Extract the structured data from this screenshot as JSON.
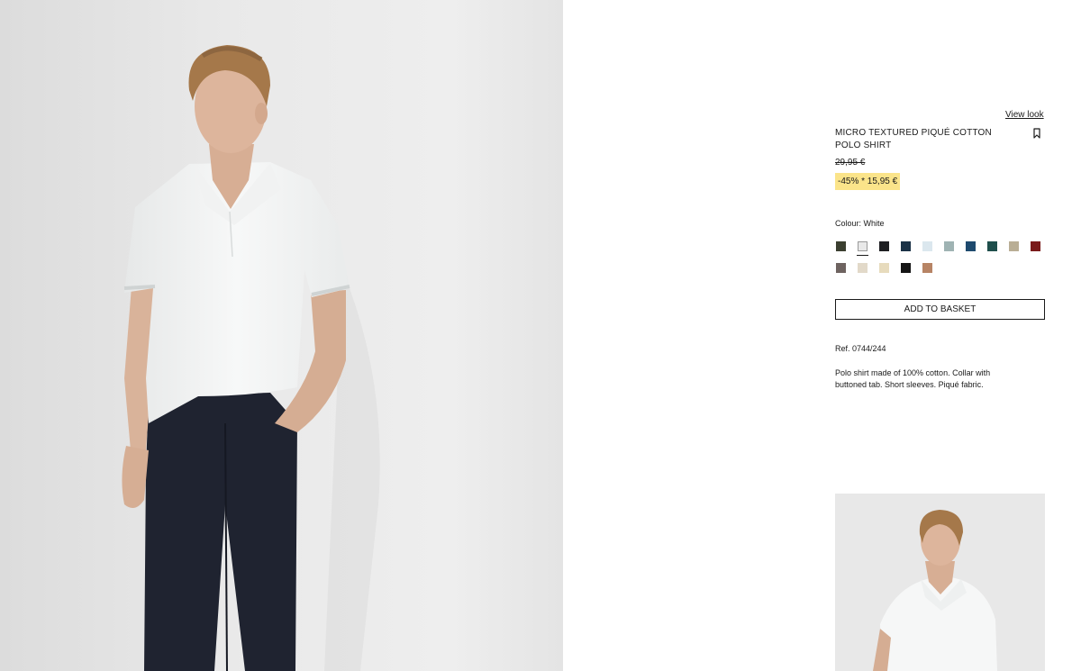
{
  "main_image": {
    "alt": "Model wearing white micro textured piqué polo shirt"
  },
  "product": {
    "view_look": "View look",
    "title": "MICRO TEXTURED PIQUÉ COTTON POLO SHIRT",
    "price_original": "29,95 €",
    "price_discount": "-45% * 15,95 €",
    "colour_label": "Colour: White",
    "add_to_basket": "ADD TO BASKET",
    "ref": "Ref. 0744/244",
    "description": "Polo shirt made of 100% cotton. Collar with buttoned tab. Short sleeves. Piqué fabric.",
    "bookmark_icon": "bookmark-icon",
    "selected_colour": "White"
  },
  "swatches": [
    {
      "color": "#3b3f30"
    },
    {
      "color": "#e9e9e9"
    },
    {
      "color": "#1e1f22"
    },
    {
      "color": "#1b3246"
    },
    {
      "color": "#dbe7ee"
    },
    {
      "color": "#9fb3b3"
    },
    {
      "color": "#1e4a6e"
    },
    {
      "color": "#1f4f4c"
    },
    {
      "color": "#b9ae95"
    },
    {
      "color": "#7a1a1a"
    },
    {
      "color": "#6e6360"
    },
    {
      "color": "#e2d9c9"
    },
    {
      "color": "#e7dbbd"
    },
    {
      "color": "#151515"
    },
    {
      "color": "#b78465"
    }
  ],
  "thumbnail": {
    "alt": "Close-up of model in white polo shirt"
  }
}
